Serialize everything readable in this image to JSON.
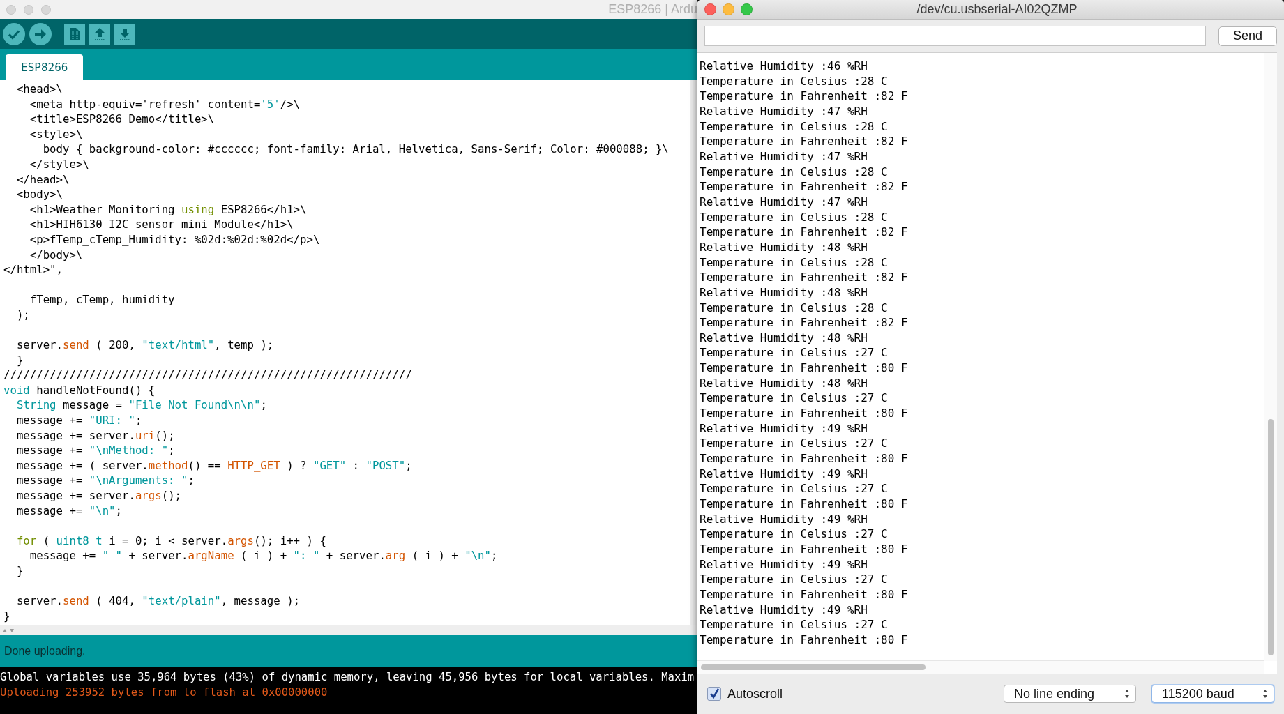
{
  "ide": {
    "title": "ESP8266 | Ardu",
    "tabs": [
      {
        "label": "ESP8266",
        "selected": true
      }
    ],
    "code": [
      {
        "segments": [
          {
            "kind": "plain",
            "text": "  <head>\\"
          }
        ]
      },
      {
        "segments": [
          {
            "kind": "plain",
            "text": "    <meta http-equiv='refresh' content="
          },
          {
            "kind": "string",
            "text": "'5'"
          },
          {
            "kind": "plain",
            "text": "/>\\"
          }
        ]
      },
      {
        "segments": [
          {
            "kind": "plain",
            "text": "    <title>ESP8266 Demo</title>\\"
          }
        ]
      },
      {
        "segments": [
          {
            "kind": "plain",
            "text": "    <style>\\"
          }
        ]
      },
      {
        "segments": [
          {
            "kind": "plain",
            "text": "      body { background-color: #cccccc; font-family: Arial, Helvetica, Sans-Serif; Color: #000088; }\\"
          }
        ]
      },
      {
        "segments": [
          {
            "kind": "plain",
            "text": "    </style>\\"
          }
        ]
      },
      {
        "segments": [
          {
            "kind": "plain",
            "text": "  </head>\\"
          }
        ]
      },
      {
        "segments": [
          {
            "kind": "plain",
            "text": "  <body>\\"
          }
        ]
      },
      {
        "segments": [
          {
            "kind": "plain",
            "text": "    <h1>Weather Monitoring "
          },
          {
            "kind": "keyword",
            "text": "using"
          },
          {
            "kind": "plain",
            "text": " ESP8266</h1>\\"
          }
        ]
      },
      {
        "segments": [
          {
            "kind": "plain",
            "text": "    <h1>HIH6130 I2C sensor mini Module</h1>\\"
          }
        ]
      },
      {
        "segments": [
          {
            "kind": "plain",
            "text": "    <p>fTemp_cTemp_Humidity: %02d:%02d:%02d</p>\\"
          }
        ]
      },
      {
        "segments": [
          {
            "kind": "plain",
            "text": "    </body>\\"
          }
        ]
      },
      {
        "segments": [
          {
            "kind": "plain",
            "text": "</html>\","
          }
        ]
      },
      {
        "space_before": true,
        "segments": [
          {
            "kind": "plain",
            "text": "    fTemp, cTemp, humidity"
          }
        ]
      },
      {
        "segments": [
          {
            "kind": "plain",
            "text": "  );"
          }
        ]
      },
      {
        "space_before": true,
        "segments": [
          {
            "kind": "plain",
            "text": "  server."
          },
          {
            "kind": "function",
            "text": "send"
          },
          {
            "kind": "plain",
            "text": " ( 200, "
          },
          {
            "kind": "string",
            "text": "\"text/html\""
          },
          {
            "kind": "plain",
            "text": ", temp );"
          }
        ]
      },
      {
        "segments": [
          {
            "kind": "plain",
            "text": "  }"
          }
        ]
      },
      {
        "segments": [
          {
            "kind": "plain",
            "text": "//////////////////////////////////////////////////////////////"
          }
        ]
      },
      {
        "segments": [
          {
            "kind": "type",
            "text": "void"
          },
          {
            "kind": "plain",
            "text": " handleNotFound() {"
          }
        ]
      },
      {
        "segments": [
          {
            "kind": "type",
            "text": "  String"
          },
          {
            "kind": "plain",
            "text": " message = "
          },
          {
            "kind": "string",
            "text": "\"File Not Found\\n\\n\""
          },
          {
            "kind": "plain",
            "text": ";"
          }
        ]
      },
      {
        "segments": [
          {
            "kind": "plain",
            "text": "  message += "
          },
          {
            "kind": "string",
            "text": "\"URI: \""
          },
          {
            "kind": "plain",
            "text": ";"
          }
        ]
      },
      {
        "segments": [
          {
            "kind": "plain",
            "text": "  message += server."
          },
          {
            "kind": "function",
            "text": "uri"
          },
          {
            "kind": "plain",
            "text": "();"
          }
        ]
      },
      {
        "segments": [
          {
            "kind": "plain",
            "text": "  message += "
          },
          {
            "kind": "string",
            "text": "\"\\nMethod: \""
          },
          {
            "kind": "plain",
            "text": ";"
          }
        ]
      },
      {
        "segments": [
          {
            "kind": "plain",
            "text": "  message += ( server."
          },
          {
            "kind": "function",
            "text": "method"
          },
          {
            "kind": "plain",
            "text": "() == "
          },
          {
            "kind": "function",
            "text": "HTTP_GET"
          },
          {
            "kind": "plain",
            "text": " ) ? "
          },
          {
            "kind": "string",
            "text": "\"GET\""
          },
          {
            "kind": "plain",
            "text": " : "
          },
          {
            "kind": "string",
            "text": "\"POST\""
          },
          {
            "kind": "plain",
            "text": ";"
          }
        ]
      },
      {
        "segments": [
          {
            "kind": "plain",
            "text": "  message += "
          },
          {
            "kind": "string",
            "text": "\"\\nArguments: \""
          },
          {
            "kind": "plain",
            "text": ";"
          }
        ]
      },
      {
        "segments": [
          {
            "kind": "plain",
            "text": "  message += server."
          },
          {
            "kind": "function",
            "text": "args"
          },
          {
            "kind": "plain",
            "text": "();"
          }
        ]
      },
      {
        "segments": [
          {
            "kind": "plain",
            "text": "  message += "
          },
          {
            "kind": "string",
            "text": "\"\\n\""
          },
          {
            "kind": "plain",
            "text": ";"
          }
        ]
      },
      {
        "space_before": true,
        "segments": [
          {
            "kind": "keyword",
            "text": "  for"
          },
          {
            "kind": "plain",
            "text": " ( "
          },
          {
            "kind": "type",
            "text": "uint8_t"
          },
          {
            "kind": "plain",
            "text": " i = 0; i < server."
          },
          {
            "kind": "function",
            "text": "args"
          },
          {
            "kind": "plain",
            "text": "(); i++ ) {"
          }
        ]
      },
      {
        "segments": [
          {
            "kind": "plain",
            "text": "    message += "
          },
          {
            "kind": "string",
            "text": "\" \""
          },
          {
            "kind": "plain",
            "text": " + server."
          },
          {
            "kind": "function",
            "text": "argName"
          },
          {
            "kind": "plain",
            "text": " ( i ) + "
          },
          {
            "kind": "string",
            "text": "\": \""
          },
          {
            "kind": "plain",
            "text": " + server."
          },
          {
            "kind": "function",
            "text": "arg"
          },
          {
            "kind": "plain",
            "text": " ( i ) + "
          },
          {
            "kind": "string",
            "text": "\"\\n\""
          },
          {
            "kind": "plain",
            "text": ";"
          }
        ]
      },
      {
        "segments": [
          {
            "kind": "plain",
            "text": "  }"
          }
        ]
      },
      {
        "space_before": true,
        "segments": [
          {
            "kind": "plain",
            "text": "  server."
          },
          {
            "kind": "function",
            "text": "send"
          },
          {
            "kind": "plain",
            "text": " ( 404, "
          },
          {
            "kind": "string",
            "text": "\"text/plain\""
          },
          {
            "kind": "plain",
            "text": ", message );"
          }
        ]
      },
      {
        "segments": [
          {
            "kind": "plain",
            "text": "}"
          }
        ]
      }
    ],
    "status": "Done uploading.",
    "console": [
      {
        "kind": "info",
        "text": "Global variables use 35,964 bytes (43%) of dynamic memory, leaving 45,956 bytes for local variables. Maxim"
      },
      {
        "kind": "progress",
        "text": "Uploading 253952 bytes from to flash at 0x00000000"
      }
    ]
  },
  "serial": {
    "title": "/dev/cu.usbserial-AI02QZMP",
    "send": "Send",
    "lines": [
      "Relative Humidity :46 %RH",
      "Temperature in Celsius :28 C",
      "Temperature in Fahrenheit :82 F",
      "Relative Humidity :47 %RH",
      "Temperature in Celsius :28 C",
      "Temperature in Fahrenheit :82 F",
      "Relative Humidity :47 %RH",
      "Temperature in Celsius :28 C",
      "Temperature in Fahrenheit :82 F",
      "Relative Humidity :47 %RH",
      "Temperature in Celsius :28 C",
      "Temperature in Fahrenheit :82 F",
      "Relative Humidity :48 %RH",
      "Temperature in Celsius :28 C",
      "Temperature in Fahrenheit :82 F",
      "Relative Humidity :48 %RH",
      "Temperature in Celsius :28 C",
      "Temperature in Fahrenheit :82 F",
      "Relative Humidity :48 %RH",
      "Temperature in Celsius :27 C",
      "Temperature in Fahrenheit :80 F",
      "Relative Humidity :48 %RH",
      "Temperature in Celsius :27 C",
      "Temperature in Fahrenheit :80 F",
      "Relative Humidity :49 %RH",
      "Temperature in Celsius :27 C",
      "Temperature in Fahrenheit :80 F",
      "Relative Humidity :49 %RH",
      "Temperature in Celsius :27 C",
      "Temperature in Fahrenheit :80 F",
      "Relative Humidity :49 %RH",
      "Temperature in Celsius :27 C",
      "Temperature in Fahrenheit :80 F",
      "Relative Humidity :49 %RH",
      "Temperature in Celsius :27 C",
      "Temperature in Fahrenheit :80 F",
      "Relative Humidity :49 %RH",
      "Temperature in Celsius :27 C",
      "Temperature in Fahrenheit :80 F"
    ],
    "autoscroll": {
      "label": "Autoscroll",
      "checked": true
    },
    "line_ending": "No line ending",
    "baud": "115200 baud"
  }
}
